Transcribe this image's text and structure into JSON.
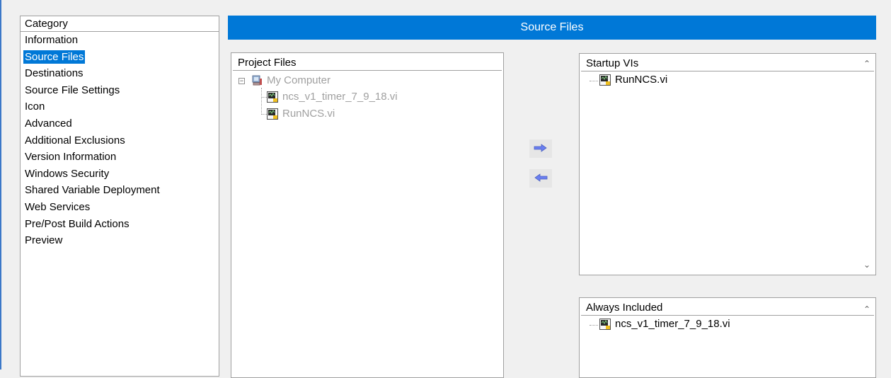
{
  "category": {
    "header": "Category",
    "items": [
      {
        "label": "Information"
      },
      {
        "label": "Source Files"
      },
      {
        "label": "Destinations"
      },
      {
        "label": "Source File Settings"
      },
      {
        "label": "Icon"
      },
      {
        "label": "Advanced"
      },
      {
        "label": "Additional Exclusions"
      },
      {
        "label": "Version Information"
      },
      {
        "label": "Windows Security"
      },
      {
        "label": "Shared Variable Deployment"
      },
      {
        "label": "Web Services"
      },
      {
        "label": "Pre/Post Build Actions"
      },
      {
        "label": "Preview"
      }
    ],
    "selected": "Source Files"
  },
  "title": "Source Files",
  "project_files": {
    "header": "Project Files",
    "root": "My Computer",
    "children": [
      "ncs_v1_timer_7_9_18.vi",
      "RunNCS.vi"
    ]
  },
  "startup_vis": {
    "header": "Startup VIs",
    "items": [
      "RunNCS.vi"
    ]
  },
  "always_included": {
    "header": "Always Included",
    "items": [
      "ncs_v1_timer_7_9_18.vi"
    ]
  },
  "buttons": {
    "add_icon": "right-arrow-icon",
    "remove_icon": "left-arrow-icon"
  },
  "colors": {
    "accent": "#0078d7",
    "arrow": "#6a7ff0",
    "disabled_text": "#a0a0a0"
  }
}
